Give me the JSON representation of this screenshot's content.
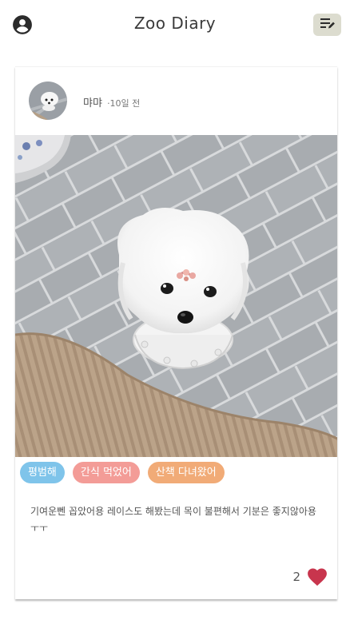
{
  "header": {
    "title": "Zoo Diary",
    "profile_icon": "account-circle-icon",
    "write_icon": "edit-list-icon"
  },
  "post": {
    "author": "먀먀",
    "time": "·10일 전",
    "tags": [
      {
        "label": "평범해",
        "color": "#7fc4ea"
      },
      {
        "label": "간식 먹었어",
        "color": "#f39c97"
      },
      {
        "label": "산책 다녀왔어",
        "color": "#f1ab77"
      }
    ],
    "text": "기여운뻰 꼽았어용 레이스도 해봤는데 목이 불편해서 기분은 좋지않아용ㅜㅜ",
    "likes": "2",
    "like_color": "#c8354d"
  }
}
